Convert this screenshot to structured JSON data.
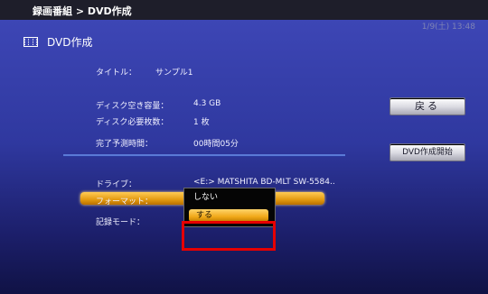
{
  "header": {
    "breadcrumb": "録画番組 > DVD作成",
    "clock": "1/9(土) 13:48"
  },
  "page": {
    "title": "DVD作成",
    "icon": "film-icon"
  },
  "info": {
    "title_label": "タイトル：",
    "title_value": "サンプル1",
    "free_space_label": "ディスク空き容量：",
    "free_space_value": "4.3 GB",
    "discs_needed_label": "ディスク必要枚数：",
    "discs_needed_value": "1 枚",
    "completion_label": "完了予測時間：",
    "completion_value": "00時間05分"
  },
  "settings": {
    "drive_label": "ドライブ：",
    "drive_value": "<E:> MATSHITA BD-MLT SW-5584..",
    "format_label": "フォーマット：",
    "record_mode_label": "記録モード："
  },
  "dropdown": {
    "options": [
      "しない",
      "する"
    ],
    "selected": "する"
  },
  "buttons": {
    "back": "戻る",
    "start": "DVD作成開始"
  },
  "colors": {
    "highlight_accent": "#e39a10",
    "annotation_box": "#e60000"
  }
}
